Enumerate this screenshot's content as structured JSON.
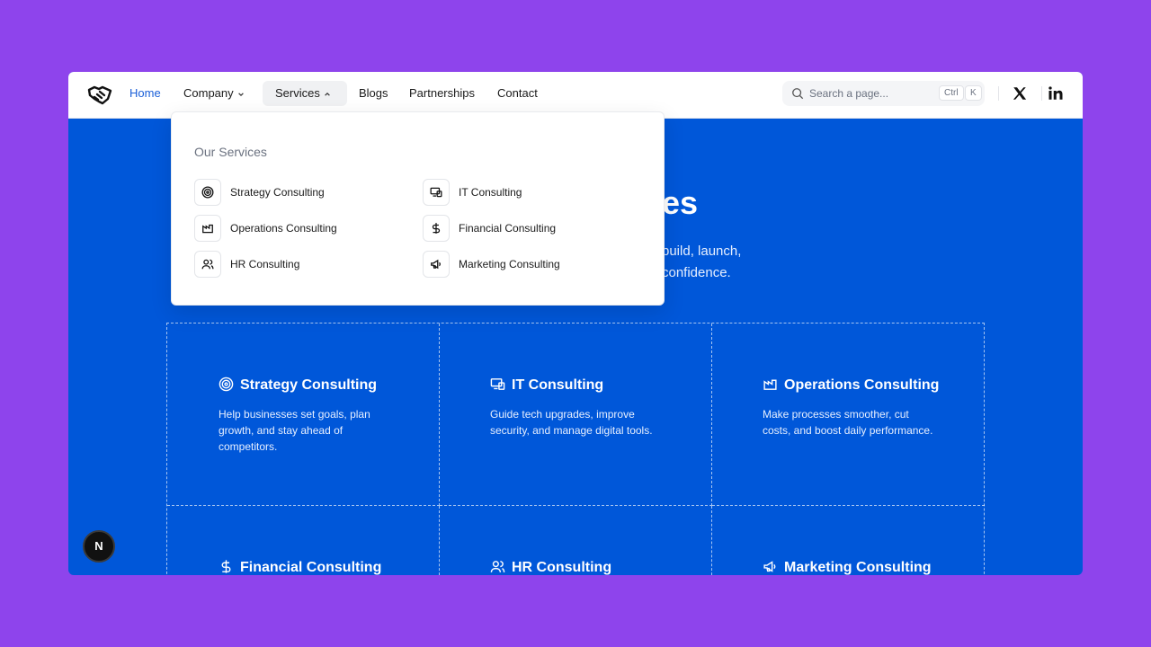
{
  "nav": {
    "home": "Home",
    "company": "Company",
    "services": "Services",
    "blogs": "Blogs",
    "partnerships": "Partnerships",
    "contact": "Contact"
  },
  "search": {
    "placeholder": "Search a page...",
    "kbd_ctrl": "Ctrl",
    "kbd_k": "K"
  },
  "dropdown": {
    "heading": "Our Services",
    "items": [
      {
        "label": "Strategy Consulting",
        "icon": "target-icon"
      },
      {
        "label": "IT Consulting",
        "icon": "devices-icon"
      },
      {
        "label": "Operations Consulting",
        "icon": "factory-icon"
      },
      {
        "label": "Financial Consulting",
        "icon": "dollar-icon"
      },
      {
        "label": "HR Consulting",
        "icon": "users-icon"
      },
      {
        "label": "Marketing Consulting",
        "icon": "megaphone-icon"
      }
    ]
  },
  "hero": {
    "title_visible": "es",
    "subtitle_line1": "build, launch,",
    "subtitle_line2": "confidence."
  },
  "cards": [
    {
      "title": "Strategy Consulting",
      "desc": "Help businesses set goals, plan growth, and stay ahead of competitors."
    },
    {
      "title": "IT Consulting",
      "desc": "Guide tech upgrades, improve security, and manage digital tools."
    },
    {
      "title": "Operations Consulting",
      "desc": "Make processes smoother, cut costs, and boost daily performance."
    },
    {
      "title": "Financial Consulting",
      "desc": ""
    },
    {
      "title": "HR Consulting",
      "desc": ""
    },
    {
      "title": "Marketing Consulting",
      "desc": ""
    }
  ],
  "badge": "N",
  "colors": {
    "background": "#8e44ec",
    "hero_blue": "#0057d9",
    "active_link": "#1a5fd8"
  }
}
